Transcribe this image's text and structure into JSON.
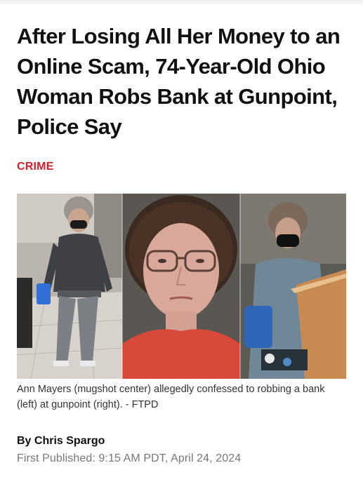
{
  "article": {
    "headline": "After Losing All Her Money to an Online Scam, 74-Year-Old Ohio Woman Robs Bank at Gunpoint, Police Say",
    "category": "CRIME",
    "caption": "Ann Mayers (mugshot center) allegedly confessed to robbing a bank (left) at gunpoint (right). - FTPD",
    "byline": "By Chris Spargo",
    "published": "First Published: 9:15 AM PDT, April 24, 2024"
  },
  "photos": [
    {
      "name": "surveillance-left"
    },
    {
      "name": "mugshot-center"
    },
    {
      "name": "surveillance-right"
    }
  ],
  "colors": {
    "category": "#d51f2b",
    "headline": "#111111",
    "caption": "#333333",
    "published": "#777777"
  }
}
